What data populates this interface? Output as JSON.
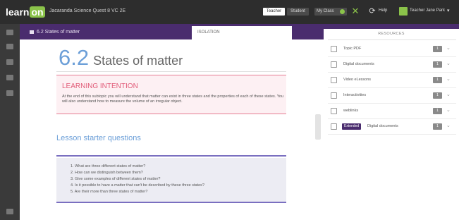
{
  "app": {
    "logo": "learn",
    "logo_accent": "on",
    "course_title": "Jacaranda Science Quest 8 VC 2E"
  },
  "topbar": {
    "teacher_label": "Teacher",
    "student_label": "Student",
    "myclass_label": "My Class",
    "help_label": "Help",
    "user_name": "Teacher Jane Park",
    "icons": [
      "close-icon",
      "refresh-icon",
      "user-avatar",
      "chevron-down-icon"
    ]
  },
  "tabs": {
    "breadcrumb": "6.2 States of matter",
    "active_tab": "ISOLATION"
  },
  "lesson": {
    "number": "6.2",
    "title": "States of matter",
    "learning_intention": {
      "heading": "LEARNING INTENTION",
      "body": "At the end of this subtopic you will understand that matter can exist in three states and the properties of each of these states. You will also understand how to measure the volume of an irregular object."
    },
    "starter": {
      "heading": "Lesson starter questions",
      "questions": [
        "1. What are three different states of matter?",
        "2. How can we distinguish between them?",
        "3. Give some examples of different states of matter?",
        "4. Is it possible to have a matter that can't be described by these three states?",
        "5. Are their more than three states of matter?"
      ]
    }
  },
  "resources": {
    "title": "RESOURCES",
    "items": [
      {
        "icon": "pdf-icon",
        "label": "Topic PDF",
        "count": "1"
      },
      {
        "icon": "document-icon",
        "label": "Digital documents",
        "count": "1"
      },
      {
        "icon": "video-icon",
        "label": "Video eLessons",
        "count": "1"
      },
      {
        "icon": "interactivity-icon",
        "label": "Interactivities",
        "count": "1"
      },
      {
        "icon": "weblink-icon",
        "label": "weblinks",
        "count": "1"
      },
      {
        "icon": "document-icon",
        "tag": "Extended",
        "label": "Digital documents",
        "count": "1"
      }
    ]
  },
  "colors": {
    "topbar": "#2d2d2d",
    "purple": "#4a2c6e",
    "accent_green": "#8bc34a",
    "heading_blue": "#6c9fd8",
    "intention_pink": "#e15b78"
  }
}
